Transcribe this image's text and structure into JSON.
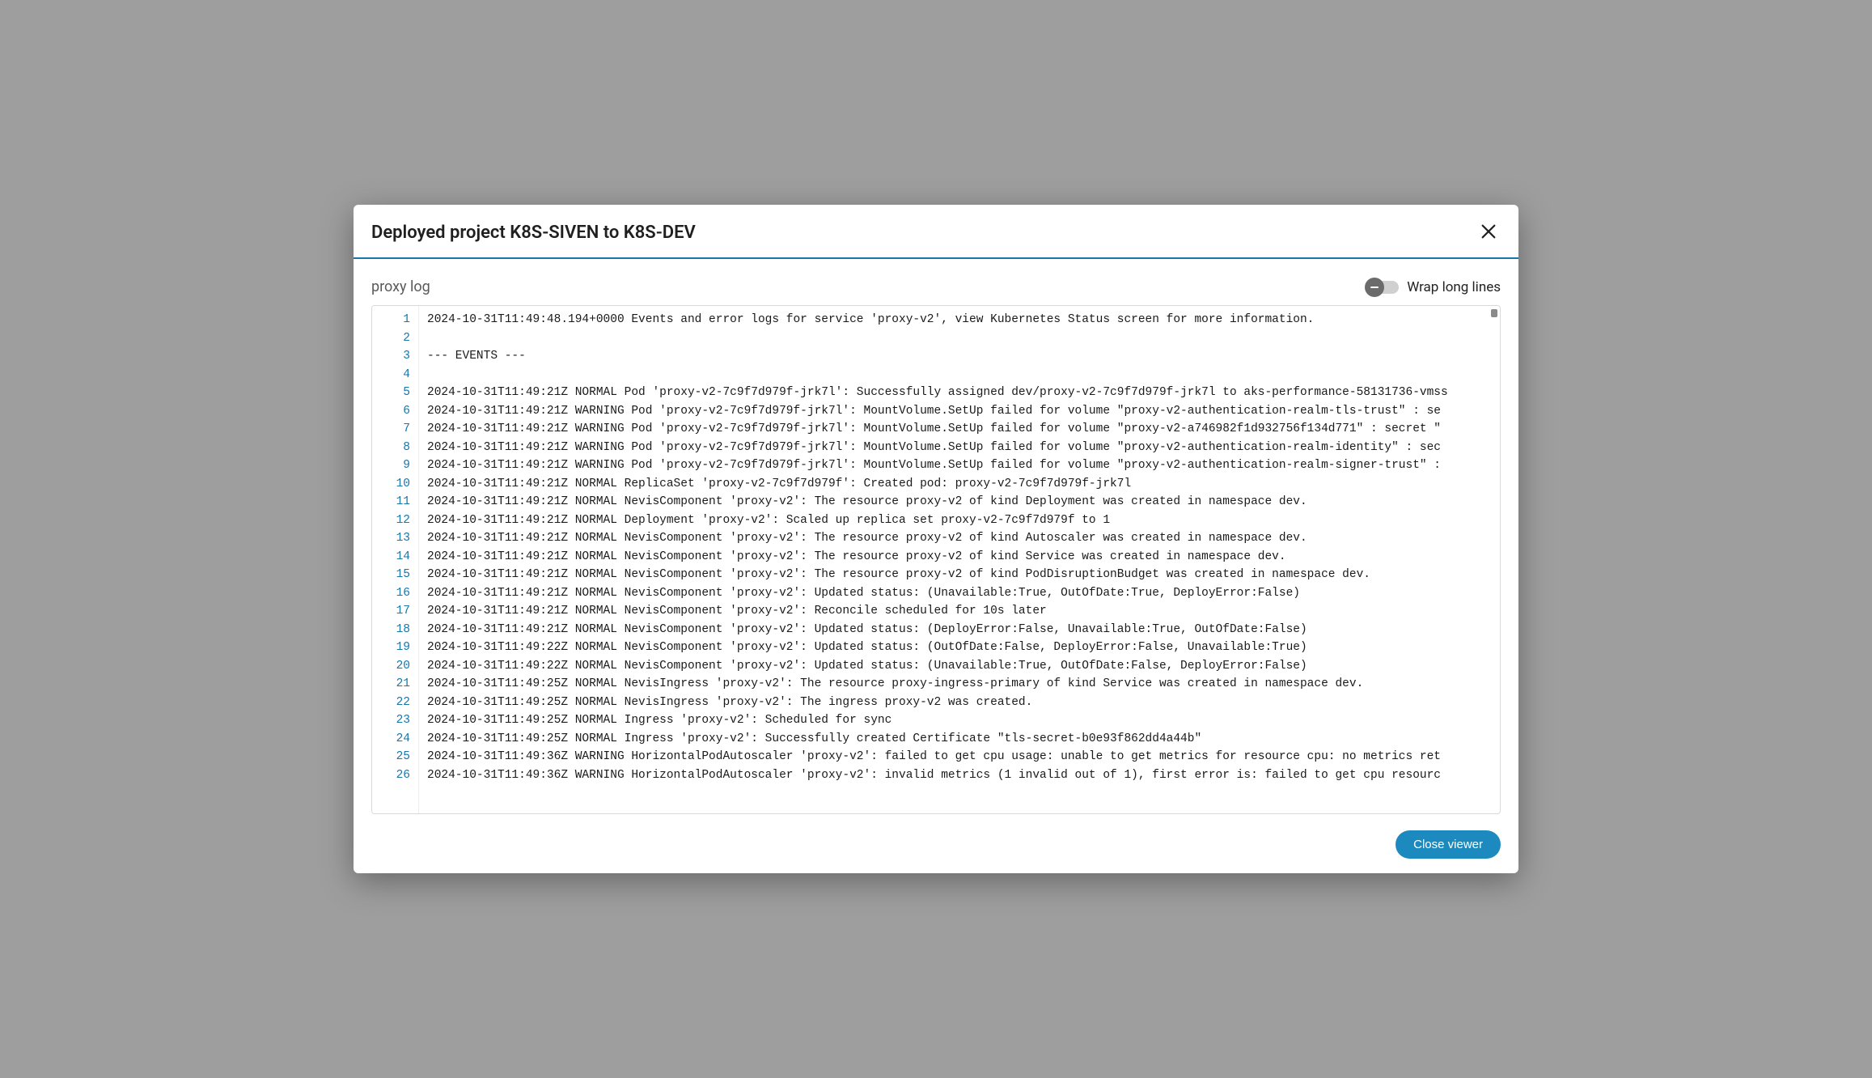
{
  "modal": {
    "title": "Deployed project K8S-SIVEN to K8S-DEV",
    "section_label": "proxy log",
    "wrap_toggle_label": "Wrap long lines",
    "close_viewer_label": "Close viewer"
  },
  "log": {
    "lines": [
      "2024-10-31T11:49:48.194+0000 Events and error logs for service 'proxy-v2', view Kubernetes Status screen for more information.",
      "",
      "--- EVENTS ---",
      "",
      "2024-10-31T11:49:21Z NORMAL Pod 'proxy-v2-7c9f7d979f-jrk7l': Successfully assigned dev/proxy-v2-7c9f7d979f-jrk7l to aks-performance-58131736-vmss",
      "2024-10-31T11:49:21Z WARNING Pod 'proxy-v2-7c9f7d979f-jrk7l': MountVolume.SetUp failed for volume \"proxy-v2-authentication-realm-tls-trust\" : se",
      "2024-10-31T11:49:21Z WARNING Pod 'proxy-v2-7c9f7d979f-jrk7l': MountVolume.SetUp failed for volume \"proxy-v2-a746982f1d932756f134d771\" : secret \"",
      "2024-10-31T11:49:21Z WARNING Pod 'proxy-v2-7c9f7d979f-jrk7l': MountVolume.SetUp failed for volume \"proxy-v2-authentication-realm-identity\" : sec",
      "2024-10-31T11:49:21Z WARNING Pod 'proxy-v2-7c9f7d979f-jrk7l': MountVolume.SetUp failed for volume \"proxy-v2-authentication-realm-signer-trust\" :",
      "2024-10-31T11:49:21Z NORMAL ReplicaSet 'proxy-v2-7c9f7d979f': Created pod: proxy-v2-7c9f7d979f-jrk7l",
      "2024-10-31T11:49:21Z NORMAL NevisComponent 'proxy-v2': The resource proxy-v2 of kind Deployment was created in namespace dev.",
      "2024-10-31T11:49:21Z NORMAL Deployment 'proxy-v2': Scaled up replica set proxy-v2-7c9f7d979f to 1",
      "2024-10-31T11:49:21Z NORMAL NevisComponent 'proxy-v2': The resource proxy-v2 of kind Autoscaler was created in namespace dev.",
      "2024-10-31T11:49:21Z NORMAL NevisComponent 'proxy-v2': The resource proxy-v2 of kind Service was created in namespace dev.",
      "2024-10-31T11:49:21Z NORMAL NevisComponent 'proxy-v2': The resource proxy-v2 of kind PodDisruptionBudget was created in namespace dev.",
      "2024-10-31T11:49:21Z NORMAL NevisComponent 'proxy-v2': Updated status: (Unavailable:True, OutOfDate:True, DeployError:False)",
      "2024-10-31T11:49:21Z NORMAL NevisComponent 'proxy-v2': Reconcile scheduled for 10s later",
      "2024-10-31T11:49:21Z NORMAL NevisComponent 'proxy-v2': Updated status: (DeployError:False, Unavailable:True, OutOfDate:False)",
      "2024-10-31T11:49:22Z NORMAL NevisComponent 'proxy-v2': Updated status: (OutOfDate:False, DeployError:False, Unavailable:True)",
      "2024-10-31T11:49:22Z NORMAL NevisComponent 'proxy-v2': Updated status: (Unavailable:True, OutOfDate:False, DeployError:False)",
      "2024-10-31T11:49:25Z NORMAL NevisIngress 'proxy-v2': The resource proxy-ingress-primary of kind Service was created in namespace dev.",
      "2024-10-31T11:49:25Z NORMAL NevisIngress 'proxy-v2': The ingress proxy-v2 was created.",
      "2024-10-31T11:49:25Z NORMAL Ingress 'proxy-v2': Scheduled for sync",
      "2024-10-31T11:49:25Z NORMAL Ingress 'proxy-v2': Successfully created Certificate \"tls-secret-b0e93f862dd4a44b\"",
      "2024-10-31T11:49:36Z WARNING HorizontalPodAutoscaler 'proxy-v2': failed to get cpu usage: unable to get metrics for resource cpu: no metrics ret",
      "2024-10-31T11:49:36Z WARNING HorizontalPodAutoscaler 'proxy-v2': invalid metrics (1 invalid out of 1), first error is: failed to get cpu resourc"
    ]
  }
}
